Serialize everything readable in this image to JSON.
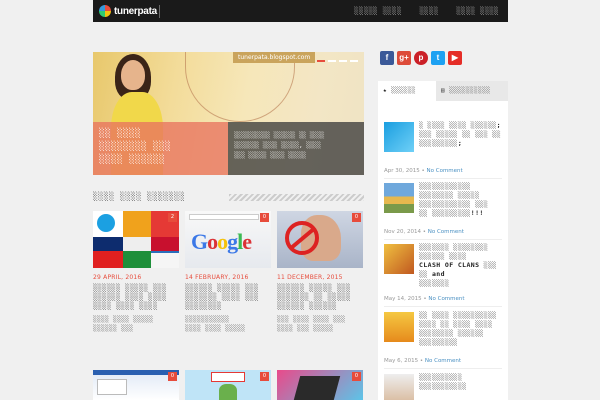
{
  "header": {
    "logo_text": "tunerpata",
    "nav": [
      "░░░░░ ░░░░",
      "░░░░",
      "░░░░ ░░░░"
    ]
  },
  "slider": {
    "tag": "tunerpata.blogspot.com",
    "caption_title": [
      "░░ ░░░░",
      "░░░░░░░░ ░░░",
      "░░░░ ░░░░░░",
      "░░░░░░░░"
    ],
    "caption_text": [
      "░░░░░░░░░░ ░░░░░░ ░░ ░░░░",
      "░░░░░░░ ░░░░ ░░░░░, ░░░░",
      "░░░ ░░░░░ ░░░░ ░░░░░"
    ]
  },
  "section": {
    "title": "░░░░ ░░░░ ░░░░░░░"
  },
  "cards": [
    {
      "badge": "2",
      "date": "29 APRIL, 2016",
      "title": [
        "░░░░░░ ░░░░░ ░░░",
        "░░░░░░ ░░░░ ░░░░",
        "░░░░ ░░░░ ░░░░"
      ],
      "excerpt": [
        "░░░░ ░░░░ ░░░░░",
        "░░░░░░ ░░░"
      ]
    },
    {
      "badge": "0",
      "date": "14 FEBRUARY, 2016",
      "title": [
        "░░░░░░ ░░░░░ ░░░",
        "░░░░░░░ ░░░░ ░░░",
        "░░░░░░░░"
      ],
      "excerpt": [
        "░░░░░░░░░░░",
        "░░░░ ░░░░ ░░░░░"
      ]
    },
    {
      "badge": "0",
      "date": "11 DECEMBER, 2015",
      "title": [
        "░░░░░░ ░░░░░ ░░░",
        "░░░░░░░ ░░ ░░░░░",
        "░░░░░░ ░░░░░░"
      ],
      "excerpt": [
        "░░░ ░░░░ ░░░░ ░░░",
        "░░░░ ░░░ ░░░░░"
      ]
    }
  ],
  "bottom_badges": [
    "0",
    "0",
    "0"
  ],
  "social": [
    "f",
    "g+",
    "p",
    "t",
    "▶"
  ],
  "sidebar": {
    "tabs": [
      {
        "icon": "★",
        "label": "░░░░░░"
      },
      {
        "icon": "▤",
        "label": "░░░░░░░░░░"
      }
    ],
    "items": [
      {
        "title": [
          "░ ░░░░ ░░░░ ░░░░░░;",
          "░░░ ░░░░░ ░░ ░░░ ░░",
          "░░░░░░░░░;"
        ],
        "date": "Apr 30, 2015",
        "comments": "No Comment"
      },
      {
        "title": [
          "░░░░░░░░░░░░",
          "░░░░░░░░ ░░░░░",
          "░░░░░░░░░░░░ ░░░",
          "░░ ░░░░░░░░░!!!"
        ],
        "date": "Nov 20, 2014",
        "comments": "No Comment"
      },
      {
        "title": [
          "░░░░░░░ ░░░░░░░░",
          "░░░░░░ ░░░░",
          "CLASH OF CLANS ░░░",
          "░░ and",
          "░░░░░░░"
        ],
        "date": "May 14, 2015",
        "comments": "No Comment"
      },
      {
        "title": [
          "░░ ░░░░ ░░░░░░░░░░",
          "░░░░ ░░ ░░░░ ░░░░",
          "░░░░░░░░ ░░░░░░",
          "░░░░░░░░░"
        ],
        "date": "May 6, 2015",
        "comments": "No Comment"
      },
      {
        "title": [
          "░░░░░░░░░░",
          "░░░░░░░░░░░"
        ],
        "date": "",
        "comments": ""
      }
    ]
  },
  "colors": {
    "accent": "#e74c3c",
    "header_bg": "#1a1a1a",
    "page_bg": "#f0f0f0",
    "link": "#4a90c2"
  }
}
